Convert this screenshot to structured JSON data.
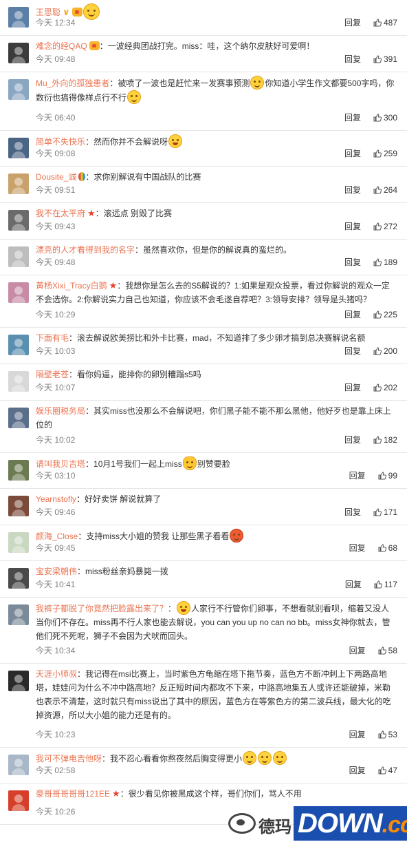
{
  "comments": [
    {
      "name": "王思聪",
      "badges": [
        "v",
        "crown"
      ],
      "segments": [
        {
          "t": "emoji",
          "k": "smile"
        }
      ],
      "time": "今天 12:34",
      "reply": "回复",
      "likes": "487",
      "color": "#5b7fa6",
      "h": 52,
      "big": true
    },
    {
      "name": "难念的经QAQ",
      "badges": [
        "crown"
      ],
      "segments": [
        {
          "t": "text",
          "v": "一波经典团战打完。miss：哇，这个纳尔皮肤好可爱啊！"
        }
      ],
      "time": "今天 09:48",
      "reply": "回复",
      "likes": "391",
      "color": "#3b3b3b",
      "h": 53
    },
    {
      "name": "Mu_外向的孤独患者",
      "badges": [],
      "segments": [
        {
          "t": "text",
          "v": "被喷了一波也是赶忙来一发赛事预测"
        },
        {
          "t": "emoji",
          "k": "smile"
        },
        {
          "t": "text",
          "v": "你知道小学生作文都要500字吗，你数衍也搞得像样点行不行"
        },
        {
          "t": "emoji",
          "k": "smile"
        }
      ],
      "time": "今天 06:40",
      "reply": "回复",
      "likes": "300",
      "color": "#8aa7c2",
      "h": 85
    },
    {
      "name": "简单不失快乐",
      "badges": [],
      "segments": [
        {
          "t": "text",
          "v": "然而你并不会解说呀"
        },
        {
          "t": "emoji",
          "k": "laugh"
        }
      ],
      "time": "今天 09:08",
      "reply": "回复",
      "likes": "259",
      "color": "#4a6584",
      "h": 52
    },
    {
      "name": "Dousite_诚",
      "badges": [
        "balloon"
      ],
      "segments": [
        {
          "t": "text",
          "v": "求你别解说有中国战队的比赛"
        }
      ],
      "time": "今天 09:51",
      "reply": "回复",
      "likes": "264",
      "color": "#c9a16b",
      "h": 53
    },
    {
      "name": "我不在太平府",
      "badges": [
        "star"
      ],
      "segments": [
        {
          "t": "text",
          "v": "滚远点 别毁了比赛"
        }
      ],
      "time": "今天 09:43",
      "reply": "回复",
      "likes": "272",
      "color": "#6b6b6b",
      "h": 53
    },
    {
      "name": "漂亮的人才看得到我的名字",
      "badges": [],
      "segments": [
        {
          "t": "text",
          "v": "虽然喜欢你，但是你的解说真的蛮烂的。"
        }
      ],
      "time": "今天 09:48",
      "reply": "回复",
      "likes": "189",
      "color": "#bdbdbd",
      "h": 52
    },
    {
      "name": "黄杨Xixi_Tracy白鹅",
      "badges": [
        "star"
      ],
      "segments": [
        {
          "t": "text",
          "v": "我想你是怎么去的S5解说的？1:如果是观众投票，看过你解说的观众一定不会选你。2:你解说实力自己也知道，你应该不会毛遂自荐吧？3:领导安排？领导是头猪吗？"
        }
      ],
      "time": "今天 10:29",
      "reply": "回复",
      "likes": "225",
      "color": "#c78ba6",
      "h": 76
    },
    {
      "name": "下面有毛",
      "badges": [],
      "segments": [
        {
          "t": "text",
          "v": "滚去解说欧美捞比和外卡比赛，mad，不知道排了多少卵才搞到总决赛解说名额"
        }
      ],
      "time": "今天 10:03",
      "reply": "回复",
      "likes": "200",
      "color": "#5a8fb0",
      "h": 53
    },
    {
      "name": "隔壁老苍",
      "badges": [],
      "segments": [
        {
          "t": "text",
          "v": "看你妈逼，能排你的卵别糟蹋s5吗"
        }
      ],
      "time": "今天 10:07",
      "reply": "回复",
      "likes": "202",
      "color": "#d8d8d8",
      "h": 53
    },
    {
      "name": "娱乐圈税务局",
      "badges": [],
      "segments": [
        {
          "t": "text",
          "v": "其实miss也没那么不会解说吧，你们黑子能不能不那么黑他，他好歹也是靠上床上位的"
        }
      ],
      "time": "今天 10:02",
      "reply": "回复",
      "likes": "182",
      "color": "#5b6e8a",
      "h": 76
    },
    {
      "name": "请叫我贝吉塔",
      "badges": [],
      "segments": [
        {
          "t": "text",
          "v": "10月1号我们一起上miss"
        },
        {
          "t": "emoji",
          "k": "cat"
        },
        {
          "t": "text",
          "v": "别赞要脸"
        }
      ],
      "time": "今天 03:10",
      "reply": "回复",
      "likes": "99",
      "color": "#6c7a52",
      "h": 52
    },
    {
      "name": "Yearnstofly",
      "badges": [],
      "segments": [
        {
          "t": "text",
          "v": "好好卖饼 解说就算了"
        }
      ],
      "time": "今天 09:46",
      "reply": "回复",
      "likes": "171",
      "color": "#7a4a3a",
      "h": 53
    },
    {
      "name": "颜海_Close",
      "badges": [],
      "segments": [
        {
          "t": "text",
          "v": "支持miss大小姐的赞我 让那些黑子看看"
        },
        {
          "t": "emoji",
          "k": "angry"
        }
      ],
      "time": "今天 09:45",
      "reply": "回复",
      "likes": "68",
      "color": "#c9d8c0",
      "h": 52
    },
    {
      "name": "宝安梁朝伟",
      "badges": [],
      "segments": [
        {
          "t": "text",
          "v": "miss粉丝亲妈暴毙一拨"
        }
      ],
      "time": "今天 10:41",
      "reply": "回复",
      "likes": "117",
      "color": "#4a4a4a",
      "h": 53
    },
    {
      "name": "我裤子都脱了你竟然把脸露出来了？",
      "badges": [],
      "segments": [
        {
          "t": "emoji",
          "k": "laugh"
        },
        {
          "t": "text",
          "v": "人家行不行管你们卵事，不想看就别看呗，缩着又没人当你们不存在。miss再不行人家也能去解说，you can you up no can no bb。miss女神你就去，管他们死不死呢，狮子不会因为犬吠而回头。"
        }
      ],
      "time": "今天 10:34",
      "reply": "回复",
      "likes": "58",
      "color": "#7a8a99",
      "h": 96
    },
    {
      "name": "天涯小师叔",
      "badges": [],
      "segments": [
        {
          "t": "text",
          "v": "我记得在msi比赛上，当时紫色方龟缩在塔下拖节奏，蓝色方不断冲刺上下两路高地塔，娃娃问为什么不冲中路高地？反正短时间内都攻不下来，中路高地集五人或许还能破掉，米勒也表示不清楚，这时就只有miss说出了其中的原因，蓝色方在等紫色方的第二波兵线，最大化的吃掉资源，所以大小姐的能力还是有的。"
        }
      ],
      "time": "今天 10:23",
      "reply": "回复",
      "likes": "53",
      "color": "#2a2a2a",
      "h": 122
    },
    {
      "name": "我可不弹电吉他呀",
      "badges": [],
      "segments": [
        {
          "t": "text",
          "v": "我不忍心看看你熬夜然后胸变得更小"
        },
        {
          "t": "emoji",
          "k": "smile"
        },
        {
          "t": "emoji",
          "k": "smile"
        },
        {
          "t": "emoji",
          "k": "smile"
        }
      ],
      "time": "今天 02:58",
      "reply": "回复",
      "likes": "47",
      "color": "#a8b8c8",
      "h": 52
    },
    {
      "name": "豪哥哥哥哥哥121EE",
      "badges": [
        "star"
      ],
      "segments": [
        {
          "t": "text",
          "v": "很少看见你被黑成这个样，哥们你们，骂人不用"
        }
      ],
      "time": "今天 10:26",
      "reply": "回复",
      "likes": "",
      "color": "#d6402a",
      "h": 60
    }
  ],
  "watermark": {
    "cn": "德玛",
    "down": "DOWN",
    "cc": ".cc"
  }
}
